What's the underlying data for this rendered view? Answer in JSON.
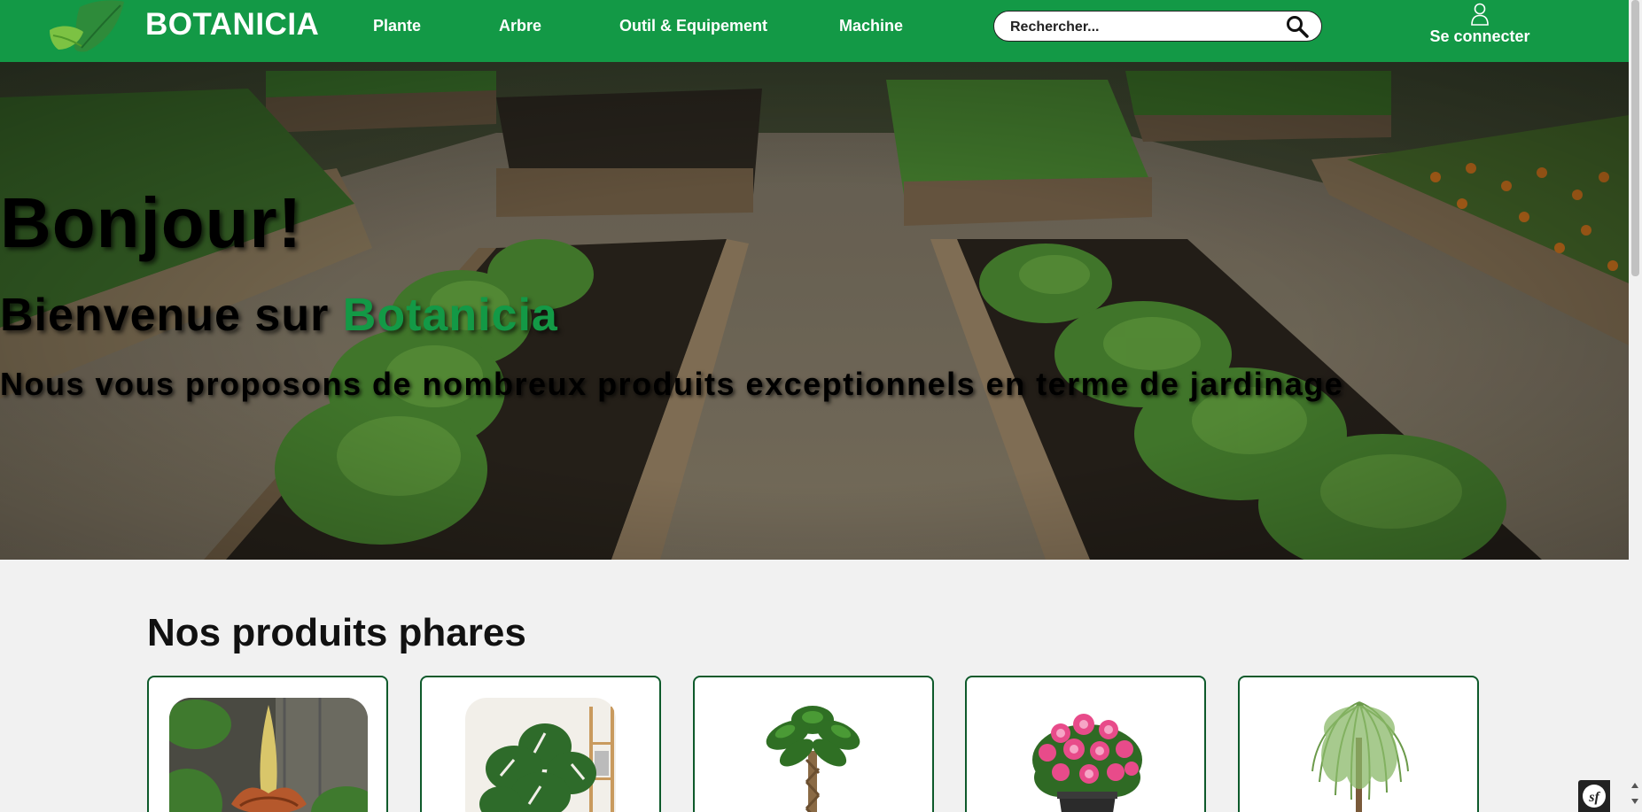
{
  "brand": {
    "name": "BOTANICIA",
    "color": "#139946"
  },
  "nav": {
    "items": [
      {
        "label": "Plante"
      },
      {
        "label": "Arbre"
      },
      {
        "label": "Outil & Equipement"
      },
      {
        "label": "Machine"
      }
    ],
    "search_placeholder": "Rechercher...",
    "login_label": "Se connecter"
  },
  "hero": {
    "title": "Bonjour!",
    "subtitle_prefix": "Bienvenue sur ",
    "subtitle_brand": "Botanicia",
    "description": "Nous vous proposons de nombreux produits exceptionnels en terme de jardinage"
  },
  "products": {
    "title": "Nos produits phares",
    "items": [
      {
        "image": "titan-arum-plant"
      },
      {
        "image": "monstera-plant"
      },
      {
        "image": "money-tree"
      },
      {
        "image": "pink-rose-bush"
      },
      {
        "image": "weeping-willow-tree"
      }
    ]
  },
  "icons": {
    "search": "search-icon",
    "user": "user-icon",
    "logo": "leaf-logo-icon",
    "devtools": "symfony-icon"
  }
}
